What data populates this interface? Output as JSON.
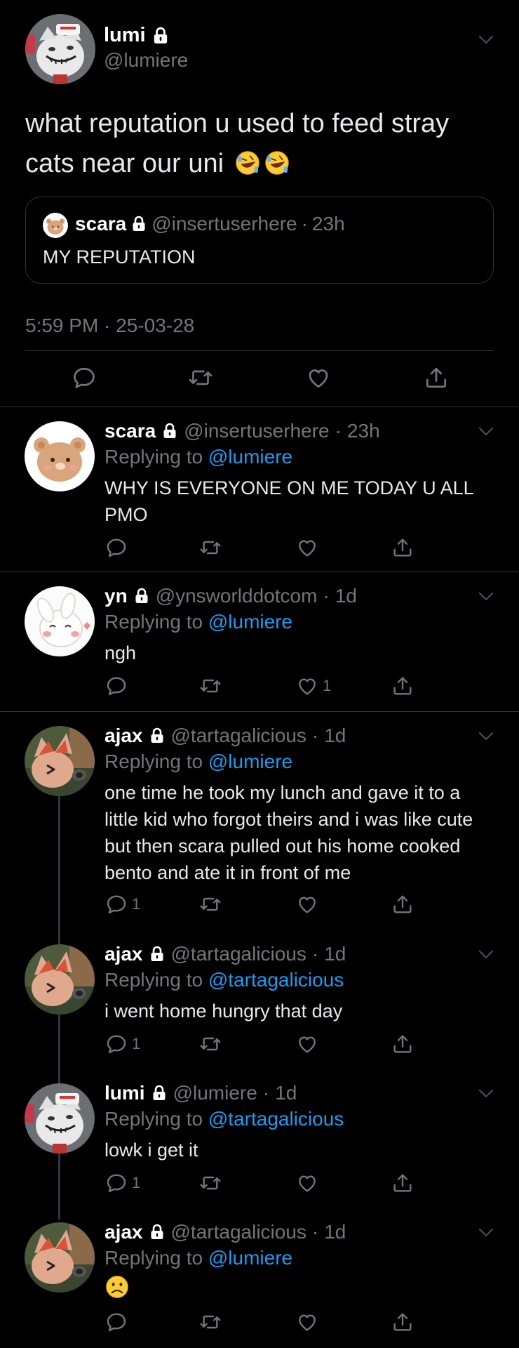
{
  "main_tweet": {
    "name": "lumi",
    "handle": "@lumiere",
    "text": "what reputation u used to feed stray cats near our uni",
    "emoji": [
      "rofl-emoji",
      "rofl-emoji"
    ],
    "quote": {
      "name": "scara",
      "handle": "@insertuserhere",
      "time": "23h",
      "text": "MY REPUTATION"
    },
    "timestamp": "5:59 PM · 25-03-28"
  },
  "replies": [
    {
      "name": "scara",
      "handle": "@insertuserhere",
      "time": "23h",
      "replying_label": "Replying to",
      "replying_to": "@lumiere",
      "text": "WHY IS EVERYONE ON ME TODAY U ALL PMO",
      "reply_count": "",
      "like_count": ""
    },
    {
      "name": "yn",
      "handle": "@ynsworlddotcom",
      "time": "1d",
      "replying_label": "Replying to",
      "replying_to": "@lumiere",
      "text": "ngh",
      "reply_count": "",
      "like_count": "1"
    },
    {
      "name": "ajax",
      "handle": "@tartagalicious",
      "time": "1d",
      "replying_label": "Replying to",
      "replying_to": "@lumiere",
      "text": "one time he took my lunch and gave it to a little kid who forgot theirs and i was like cute but then scara pulled out his home cooked bento and ate it in front of me",
      "reply_count": "1",
      "like_count": ""
    },
    {
      "name": "ajax",
      "handle": "@tartagalicious",
      "time": "1d",
      "replying_label": "Replying to",
      "replying_to": "@tartagalicious",
      "text": "i went home hungry that day",
      "reply_count": "1",
      "like_count": ""
    },
    {
      "name": "lumi",
      "handle": "@lumiere",
      "time": "1d",
      "replying_label": "Replying to",
      "replying_to": "@tartagalicious",
      "text": "lowk i get it",
      "reply_count": "1",
      "like_count": ""
    },
    {
      "name": "ajax",
      "handle": "@tartagalicious",
      "time": "1d",
      "replying_label": "Replying to",
      "replying_to": "@lumiere",
      "text": "☹️",
      "reply_count": "",
      "like_count": ""
    }
  ],
  "colors": {
    "background": "#000000",
    "text": "#e7e9ea",
    "secondary": "#71767b",
    "accent": "#1d9bf0",
    "divider": "#2f3336"
  }
}
